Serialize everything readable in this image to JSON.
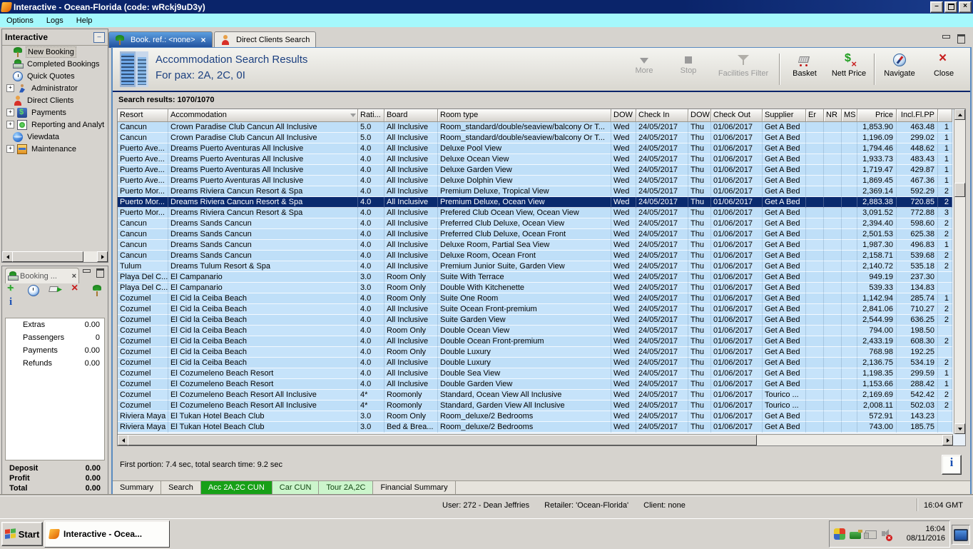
{
  "window": {
    "title": "Interactive - Ocean-Florida (code: wRckj9uD3y)",
    "menu": [
      "Options",
      "Logs",
      "Help"
    ]
  },
  "sidebar": {
    "title": "Interactive",
    "items": [
      {
        "label": "New Booking",
        "icon": "palm-tree",
        "expandable": false,
        "selected": true
      },
      {
        "label": "Completed Bookings",
        "icon": "money-palm",
        "expandable": false
      },
      {
        "label": "Quick Quotes",
        "icon": "clock",
        "expandable": false
      },
      {
        "label": "Administrator",
        "icon": "runner",
        "expandable": true
      },
      {
        "label": "Direct Clients",
        "icon": "person",
        "expandable": false
      },
      {
        "label": "Payments",
        "icon": "money",
        "expandable": true
      },
      {
        "label": "Reporting and Analyt",
        "icon": "report",
        "expandable": true
      },
      {
        "label": "Viewdata",
        "icon": "globe",
        "expandable": false
      },
      {
        "label": "Maintenance",
        "icon": "tools",
        "expandable": true
      }
    ]
  },
  "booking_panel": {
    "tab_label": "Booking ...",
    "toolbar_icons": [
      "plus",
      "clock",
      "cart-add",
      "redx",
      "palm-tree"
    ],
    "rows": [
      {
        "label": "Extras",
        "value": "0.00"
      },
      {
        "label": "Passengers",
        "value": "0"
      },
      {
        "label": "Payments",
        "value": "0.00"
      },
      {
        "label": "Refunds",
        "value": "0.00"
      }
    ],
    "totals": [
      {
        "label": "Deposit",
        "value": "0.00"
      },
      {
        "label": "Profit",
        "value": "0.00"
      },
      {
        "label": "Total",
        "value": "0.00"
      }
    ]
  },
  "tabs": [
    {
      "label": "Book. ref.: <none>",
      "icon": "palm-tree",
      "selected": true,
      "closable": true
    },
    {
      "label": "Direct Clients Search",
      "icon": "person",
      "selected": false,
      "closable": false
    }
  ],
  "header": {
    "title": "Accommodation Search Results",
    "subtitle": "For pax: 2A, 2C, 0I",
    "toolbar": [
      {
        "label": "More",
        "icon": "more",
        "disabled": true
      },
      {
        "label": "Stop",
        "icon": "stop",
        "disabled": true
      },
      {
        "label": "Facilities Filter",
        "icon": "filter",
        "disabled": true,
        "wide": true,
        "sep_after": true
      },
      {
        "label": "Basket",
        "icon": "basket",
        "disabled": false
      },
      {
        "label": "Nett Price",
        "icon": "nett",
        "disabled": false,
        "sep_after": true
      },
      {
        "label": "Navigate",
        "icon": "nav",
        "disabled": false
      },
      {
        "label": "Close",
        "icon": "close",
        "disabled": false
      }
    ]
  },
  "results": {
    "count_label": "Search results: 1070/1070",
    "status": "First portion: 7.4 sec, total search time: 9.2 sec",
    "columns": [
      "Resort",
      "Accommodation",
      "Rati...",
      "Board",
      "Room type",
      "DOW",
      "Check In",
      "DOW",
      "Check Out",
      "Supplier",
      "Er",
      "NR",
      "MS",
      "Price",
      "Incl.Fl.PP",
      ""
    ],
    "selected_index": 7,
    "rows": [
      [
        "Cancun",
        "Crown Paradise Club Cancun All Inclusive",
        "5.0",
        "All Inclusive",
        "Room_standard/double/seaview/balcony Or T...",
        "Wed",
        "24/05/2017",
        "Thu",
        "01/06/2017",
        "Get A Bed",
        "",
        "",
        "",
        "1,853.90",
        "463.48",
        "1"
      ],
      [
        "Cancun",
        "Crown Paradise Club Cancun All Inclusive",
        "5.0",
        "All Inclusive",
        "Room_standard/double/seaview/balcony Or T...",
        "Wed",
        "24/05/2017",
        "Thu",
        "01/06/2017",
        "Get A Bed",
        "",
        "",
        "",
        "1,196.09",
        "299.02",
        "1"
      ],
      [
        "Puerto Ave...",
        "Dreams Puerto Aventuras All Inclusive",
        "4.0",
        "All Inclusive",
        "Deluxe Pool View",
        "Wed",
        "24/05/2017",
        "Thu",
        "01/06/2017",
        "Get A Bed",
        "",
        "",
        "",
        "1,794.46",
        "448.62",
        "1"
      ],
      [
        "Puerto Ave...",
        "Dreams Puerto Aventuras All Inclusive",
        "4.0",
        "All Inclusive",
        "Deluxe Ocean View",
        "Wed",
        "24/05/2017",
        "Thu",
        "01/06/2017",
        "Get A Bed",
        "",
        "",
        "",
        "1,933.73",
        "483.43",
        "1"
      ],
      [
        "Puerto Ave...",
        "Dreams Puerto Aventuras All Inclusive",
        "4.0",
        "All Inclusive",
        "Deluxe Garden View",
        "Wed",
        "24/05/2017",
        "Thu",
        "01/06/2017",
        "Get A Bed",
        "",
        "",
        "",
        "1,719.47",
        "429.87",
        "1"
      ],
      [
        "Puerto Ave...",
        "Dreams Puerto Aventuras All Inclusive",
        "4.0",
        "All Inclusive",
        "Deluxe Dolphin View",
        "Wed",
        "24/05/2017",
        "Thu",
        "01/06/2017",
        "Get A Bed",
        "",
        "",
        "",
        "1,869.45",
        "467.36",
        "1"
      ],
      [
        "Puerto Mor...",
        "Dreams Riviera Cancun Resort & Spa",
        "4.0",
        "All Inclusive",
        "Premium Deluxe, Tropical View",
        "Wed",
        "24/05/2017",
        "Thu",
        "01/06/2017",
        "Get A Bed",
        "",
        "",
        "",
        "2,369.14",
        "592.29",
        "2"
      ],
      [
        "Puerto Mor...",
        "Dreams Riviera Cancun Resort & Spa",
        "4.0",
        "All Inclusive",
        "Premium Deluxe, Ocean View",
        "Wed",
        "24/05/2017",
        "Thu",
        "01/06/2017",
        "Get A Bed",
        "",
        "",
        "",
        "2,883.38",
        "720.85",
        "2"
      ],
      [
        "Puerto Mor...",
        "Dreams Riviera Cancun Resort & Spa",
        "4.0",
        "All Inclusive",
        "Prefered Club Ocean View, Ocean View",
        "Wed",
        "24/05/2017",
        "Thu",
        "01/06/2017",
        "Get A Bed",
        "",
        "",
        "",
        "3,091.52",
        "772.88",
        "3"
      ],
      [
        "Cancun",
        "Dreams Sands Cancun",
        "4.0",
        "All Inclusive",
        "Preferred Club Deluxe, Ocean View",
        "Wed",
        "24/05/2017",
        "Thu",
        "01/06/2017",
        "Get A Bed",
        "",
        "",
        "",
        "2,394.40",
        "598.60",
        "2"
      ],
      [
        "Cancun",
        "Dreams Sands Cancun",
        "4.0",
        "All Inclusive",
        "Preferred Club Deluxe, Ocean Front",
        "Wed",
        "24/05/2017",
        "Thu",
        "01/06/2017",
        "Get A Bed",
        "",
        "",
        "",
        "2,501.53",
        "625.38",
        "2"
      ],
      [
        "Cancun",
        "Dreams Sands Cancun",
        "4.0",
        "All Inclusive",
        "Deluxe Room, Partial Sea View",
        "Wed",
        "24/05/2017",
        "Thu",
        "01/06/2017",
        "Get A Bed",
        "",
        "",
        "",
        "1,987.30",
        "496.83",
        "1"
      ],
      [
        "Cancun",
        "Dreams Sands Cancun",
        "4.0",
        "All Inclusive",
        "Deluxe Room, Ocean Front",
        "Wed",
        "24/05/2017",
        "Thu",
        "01/06/2017",
        "Get A Bed",
        "",
        "",
        "",
        "2,158.71",
        "539.68",
        "2"
      ],
      [
        "Tulum",
        "Dreams Tulum Resort & Spa",
        "4.0",
        "All Inclusive",
        "Premium Junior Suite, Garden View",
        "Wed",
        "24/05/2017",
        "Thu",
        "01/06/2017",
        "Get A Bed",
        "",
        "",
        "",
        "2,140.72",
        "535.18",
        "2"
      ],
      [
        "Playa Del C...",
        "El Campanario",
        "3.0",
        "Room Only",
        "Suite With Terrace",
        "Wed",
        "24/05/2017",
        "Thu",
        "01/06/2017",
        "Get A Bed",
        "",
        "",
        "",
        "949.19",
        "237.30",
        ""
      ],
      [
        "Playa Del C...",
        "El Campanario",
        "3.0",
        "Room Only",
        "Double With Kitchenette",
        "Wed",
        "24/05/2017",
        "Thu",
        "01/06/2017",
        "Get A Bed",
        "",
        "",
        "",
        "539.33",
        "134.83",
        ""
      ],
      [
        "Cozumel",
        "El Cid la Ceiba Beach",
        "4.0",
        "Room Only",
        "Suite One Room",
        "Wed",
        "24/05/2017",
        "Thu",
        "01/06/2017",
        "Get A Bed",
        "",
        "",
        "",
        "1,142.94",
        "285.74",
        "1"
      ],
      [
        "Cozumel",
        "El Cid la Ceiba Beach",
        "4.0",
        "All Inclusive",
        "Suite Ocean Front-premium",
        "Wed",
        "24/05/2017",
        "Thu",
        "01/06/2017",
        "Get A Bed",
        "",
        "",
        "",
        "2,841.06",
        "710.27",
        "2"
      ],
      [
        "Cozumel",
        "El Cid la Ceiba Beach",
        "4.0",
        "All Inclusive",
        "Suite Garden View",
        "Wed",
        "24/05/2017",
        "Thu",
        "01/06/2017",
        "Get A Bed",
        "",
        "",
        "",
        "2,544.99",
        "636.25",
        "2"
      ],
      [
        "Cozumel",
        "El Cid la Ceiba Beach",
        "4.0",
        "Room Only",
        "Double Ocean View",
        "Wed",
        "24/05/2017",
        "Thu",
        "01/06/2017",
        "Get A Bed",
        "",
        "",
        "",
        "794.00",
        "198.50",
        ""
      ],
      [
        "Cozumel",
        "El Cid la Ceiba Beach",
        "4.0",
        "All Inclusive",
        "Double Ocean Front-premium",
        "Wed",
        "24/05/2017",
        "Thu",
        "01/06/2017",
        "Get A Bed",
        "",
        "",
        "",
        "2,433.19",
        "608.30",
        "2"
      ],
      [
        "Cozumel",
        "El Cid la Ceiba Beach",
        "4.0",
        "Room Only",
        "Double Luxury",
        "Wed",
        "24/05/2017",
        "Thu",
        "01/06/2017",
        "Get A Bed",
        "",
        "",
        "",
        "768.98",
        "192.25",
        ""
      ],
      [
        "Cozumel",
        "El Cid la Ceiba Beach",
        "4.0",
        "All Inclusive",
        "Double Luxury",
        "Wed",
        "24/05/2017",
        "Thu",
        "01/06/2017",
        "Get A Bed",
        "",
        "",
        "",
        "2,136.75",
        "534.19",
        "2"
      ],
      [
        "Cozumel",
        "El Cozumeleno Beach Resort",
        "4.0",
        "All Inclusive",
        "Double Sea View",
        "Wed",
        "24/05/2017",
        "Thu",
        "01/06/2017",
        "Get A Bed",
        "",
        "",
        "",
        "1,198.35",
        "299.59",
        "1"
      ],
      [
        "Cozumel",
        "El Cozumeleno Beach Resort",
        "4.0",
        "All Inclusive",
        "Double Garden View",
        "Wed",
        "24/05/2017",
        "Thu",
        "01/06/2017",
        "Get A Bed",
        "",
        "",
        "",
        "1,153.66",
        "288.42",
        "1"
      ],
      [
        "Cozumel",
        "El Cozumeleno Beach Resort All Inclusive",
        "4*",
        "Roomonly",
        "Standard, Ocean View All Inclusive",
        "Wed",
        "24/05/2017",
        "Thu",
        "01/06/2017",
        "Tourico ...",
        "",
        "",
        "",
        "2,169.69",
        "542.42",
        "2"
      ],
      [
        "Cozumel",
        "El Cozumeleno Beach Resort All Inclusive",
        "4*",
        "Roomonly",
        "Standard, Garden View All Inclusive",
        "Wed",
        "24/05/2017",
        "Thu",
        "01/06/2017",
        "Tourico ...",
        "",
        "",
        "",
        "2,008.11",
        "502.03",
        "2"
      ],
      [
        "Riviera Maya",
        "El Tukan Hotel Beach Club",
        "3.0",
        "Room Only",
        "Room_deluxe/2 Bedrooms",
        "Wed",
        "24/05/2017",
        "Thu",
        "01/06/2017",
        "Get A Bed",
        "",
        "",
        "",
        "572.91",
        "143.23",
        ""
      ],
      [
        "Riviera Maya",
        "El Tukan Hotel Beach Club",
        "3.0",
        "Bed & Brea...",
        "Room_deluxe/2 Bedrooms",
        "Wed",
        "24/05/2017",
        "Thu",
        "01/06/2017",
        "Get A Bed",
        "",
        "",
        "",
        "743.00",
        "185.75",
        ""
      ]
    ]
  },
  "bottom_tabs": [
    {
      "label": "Summary",
      "style": "plain"
    },
    {
      "label": "Search",
      "style": "plain"
    },
    {
      "label": "Acc 2A,2C CUN",
      "style": "green-sel"
    },
    {
      "label": "Car CUN",
      "style": "green"
    },
    {
      "label": "Tour 2A,2C",
      "style": "green"
    },
    {
      "label": "Financial Summary",
      "style": "plain"
    }
  ],
  "statusbar": {
    "user": "User: 272 - Dean Jeffries",
    "retailer": "Retailer: 'Ocean-Florida'",
    "client": "Client: none",
    "time": "16:04 GMT"
  },
  "taskbar": {
    "start_label": "Start",
    "task_label": "Interactive - Ocea...",
    "tray_icons": [
      "security",
      "net-card",
      "network",
      "volume-muted"
    ],
    "tray_time": "16:04",
    "tray_date": "08/11/2016"
  },
  "colors": {
    "titlebar": "#0A246A",
    "menubar": "#A4F8FC",
    "row_blue": "#BFDFF8",
    "selected_row": "#0A2A6E",
    "green_tab": "#17A017"
  }
}
